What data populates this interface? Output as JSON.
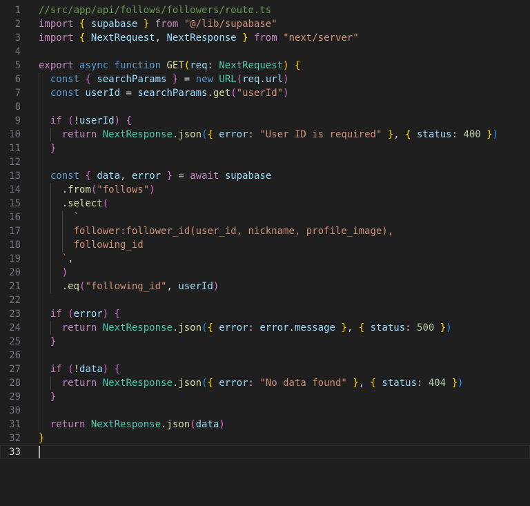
{
  "editor": {
    "file_comment": "//src/app/api/follows/followers/route.ts",
    "lines": [
      {
        "n": "1",
        "indent": 0,
        "tokens": [
          [
            "com",
            "//src/app/api/follows/followers/route.ts"
          ]
        ]
      },
      {
        "n": "2",
        "indent": 0,
        "tokens": [
          [
            "kw",
            "import"
          ],
          [
            "pl",
            " "
          ],
          [
            "b1",
            "{"
          ],
          [
            "pl",
            " "
          ],
          [
            "var",
            "supabase"
          ],
          [
            "pl",
            " "
          ],
          [
            "b1",
            "}"
          ],
          [
            "pl",
            " "
          ],
          [
            "kw",
            "from"
          ],
          [
            "pl",
            " "
          ],
          [
            "str",
            "\"@/lib/supabase\""
          ]
        ]
      },
      {
        "n": "3",
        "indent": 0,
        "tokens": [
          [
            "kw",
            "import"
          ],
          [
            "pl",
            " "
          ],
          [
            "b1",
            "{"
          ],
          [
            "pl",
            " "
          ],
          [
            "var",
            "NextRequest"
          ],
          [
            "pl",
            ", "
          ],
          [
            "var",
            "NextResponse"
          ],
          [
            "pl",
            " "
          ],
          [
            "b1",
            "}"
          ],
          [
            "pl",
            " "
          ],
          [
            "kw",
            "from"
          ],
          [
            "pl",
            " "
          ],
          [
            "str",
            "\"next/server\""
          ]
        ]
      },
      {
        "n": "4",
        "indent": 0,
        "tokens": []
      },
      {
        "n": "5",
        "indent": 0,
        "tokens": [
          [
            "kw",
            "export"
          ],
          [
            "pl",
            " "
          ],
          [
            "dec",
            "async"
          ],
          [
            "pl",
            " "
          ],
          [
            "dec",
            "function"
          ],
          [
            "pl",
            " "
          ],
          [
            "fn",
            "GET"
          ],
          [
            "b1",
            "("
          ],
          [
            "var",
            "req"
          ],
          [
            "pl",
            ": "
          ],
          [
            "type",
            "NextRequest"
          ],
          [
            "b1",
            ")"
          ],
          [
            "pl",
            " "
          ],
          [
            "b1",
            "{"
          ]
        ]
      },
      {
        "n": "6",
        "indent": 1,
        "tokens": [
          [
            "dec",
            "const"
          ],
          [
            "pl",
            " "
          ],
          [
            "b2",
            "{"
          ],
          [
            "pl",
            " "
          ],
          [
            "var",
            "searchParams"
          ],
          [
            "pl",
            " "
          ],
          [
            "b2",
            "}"
          ],
          [
            "pl",
            " = "
          ],
          [
            "dec",
            "new"
          ],
          [
            "pl",
            " "
          ],
          [
            "type",
            "URL"
          ],
          [
            "b2",
            "("
          ],
          [
            "var",
            "req"
          ],
          [
            "pl",
            "."
          ],
          [
            "var",
            "url"
          ],
          [
            "b2",
            ")"
          ]
        ]
      },
      {
        "n": "7",
        "indent": 1,
        "tokens": [
          [
            "dec",
            "const"
          ],
          [
            "pl",
            " "
          ],
          [
            "var",
            "userId"
          ],
          [
            "pl",
            " = "
          ],
          [
            "var",
            "searchParams"
          ],
          [
            "pl",
            "."
          ],
          [
            "fn",
            "get"
          ],
          [
            "b2",
            "("
          ],
          [
            "str",
            "\"userId\""
          ],
          [
            "b2",
            ")"
          ]
        ]
      },
      {
        "n": "8",
        "indent": 1,
        "tokens": []
      },
      {
        "n": "9",
        "indent": 1,
        "tokens": [
          [
            "kw",
            "if"
          ],
          [
            "pl",
            " "
          ],
          [
            "b2",
            "("
          ],
          [
            "pl",
            "!"
          ],
          [
            "var",
            "userId"
          ],
          [
            "b2",
            ")"
          ],
          [
            "pl",
            " "
          ],
          [
            "b2",
            "{"
          ]
        ]
      },
      {
        "n": "10",
        "indent": 2,
        "tokens": [
          [
            "kw",
            "return"
          ],
          [
            "pl",
            " "
          ],
          [
            "type",
            "NextResponse"
          ],
          [
            "pl",
            "."
          ],
          [
            "fn",
            "json"
          ],
          [
            "b3",
            "("
          ],
          [
            "b1",
            "{"
          ],
          [
            "pl",
            " "
          ],
          [
            "var",
            "error"
          ],
          [
            "pl",
            ": "
          ],
          [
            "str",
            "\"User ID is required\""
          ],
          [
            "pl",
            " "
          ],
          [
            "b1",
            "}"
          ],
          [
            "pl",
            ", "
          ],
          [
            "b1",
            "{"
          ],
          [
            "pl",
            " "
          ],
          [
            "var",
            "status"
          ],
          [
            "pl",
            ": "
          ],
          [
            "num",
            "400"
          ],
          [
            "pl",
            " "
          ],
          [
            "b1",
            "}"
          ],
          [
            "b3",
            ")"
          ]
        ]
      },
      {
        "n": "11",
        "indent": 1,
        "tokens": [
          [
            "b2",
            "}"
          ]
        ]
      },
      {
        "n": "12",
        "indent": 1,
        "tokens": []
      },
      {
        "n": "13",
        "indent": 1,
        "tokens": [
          [
            "dec",
            "const"
          ],
          [
            "pl",
            " "
          ],
          [
            "b2",
            "{"
          ],
          [
            "pl",
            " "
          ],
          [
            "var",
            "data"
          ],
          [
            "pl",
            ", "
          ],
          [
            "var",
            "error"
          ],
          [
            "pl",
            " "
          ],
          [
            "b2",
            "}"
          ],
          [
            "pl",
            " = "
          ],
          [
            "kw",
            "await"
          ],
          [
            "pl",
            " "
          ],
          [
            "var",
            "supabase"
          ]
        ]
      },
      {
        "n": "14",
        "indent": 2,
        "tokens": [
          [
            "pl",
            "."
          ],
          [
            "fn",
            "from"
          ],
          [
            "b2",
            "("
          ],
          [
            "str",
            "\"follows\""
          ],
          [
            "b2",
            ")"
          ]
        ]
      },
      {
        "n": "15",
        "indent": 2,
        "tokens": [
          [
            "pl",
            "."
          ],
          [
            "fn",
            "select"
          ],
          [
            "b2",
            "("
          ]
        ]
      },
      {
        "n": "16",
        "indent": 3,
        "tokens": [
          [
            "str",
            "`"
          ]
        ]
      },
      {
        "n": "17",
        "indent": 3,
        "tokens": [
          [
            "str",
            "follower:follower_id(user_id, nickname, profile_image),"
          ]
        ]
      },
      {
        "n": "18",
        "indent": 3,
        "tokens": [
          [
            "str",
            "following_id"
          ]
        ]
      },
      {
        "n": "19",
        "indent": 2,
        "tokens": [
          [
            "str",
            "`"
          ],
          [
            "pl",
            ","
          ]
        ]
      },
      {
        "n": "20",
        "indent": 2,
        "tokens": [
          [
            "b2",
            ")"
          ]
        ]
      },
      {
        "n": "21",
        "indent": 2,
        "tokens": [
          [
            "pl",
            "."
          ],
          [
            "fn",
            "eq"
          ],
          [
            "b2",
            "("
          ],
          [
            "str",
            "\"following_id\""
          ],
          [
            "pl",
            ", "
          ],
          [
            "var",
            "userId"
          ],
          [
            "b2",
            ")"
          ]
        ]
      },
      {
        "n": "22",
        "indent": 1,
        "tokens": []
      },
      {
        "n": "23",
        "indent": 1,
        "tokens": [
          [
            "kw",
            "if"
          ],
          [
            "pl",
            " "
          ],
          [
            "b2",
            "("
          ],
          [
            "var",
            "error"
          ],
          [
            "b2",
            ")"
          ],
          [
            "pl",
            " "
          ],
          [
            "b2",
            "{"
          ]
        ]
      },
      {
        "n": "24",
        "indent": 2,
        "tokens": [
          [
            "kw",
            "return"
          ],
          [
            "pl",
            " "
          ],
          [
            "type",
            "NextResponse"
          ],
          [
            "pl",
            "."
          ],
          [
            "fn",
            "json"
          ],
          [
            "b3",
            "("
          ],
          [
            "b1",
            "{"
          ],
          [
            "pl",
            " "
          ],
          [
            "var",
            "error"
          ],
          [
            "pl",
            ": "
          ],
          [
            "var",
            "error"
          ],
          [
            "pl",
            "."
          ],
          [
            "var",
            "message"
          ],
          [
            "pl",
            " "
          ],
          [
            "b1",
            "}"
          ],
          [
            "pl",
            ", "
          ],
          [
            "b1",
            "{"
          ],
          [
            "pl",
            " "
          ],
          [
            "var",
            "status"
          ],
          [
            "pl",
            ": "
          ],
          [
            "num",
            "500"
          ],
          [
            "pl",
            " "
          ],
          [
            "b1",
            "}"
          ],
          [
            "b3",
            ")"
          ]
        ]
      },
      {
        "n": "25",
        "indent": 1,
        "tokens": [
          [
            "b2",
            "}"
          ]
        ]
      },
      {
        "n": "26",
        "indent": 1,
        "tokens": []
      },
      {
        "n": "27",
        "indent": 1,
        "tokens": [
          [
            "kw",
            "if"
          ],
          [
            "pl",
            " "
          ],
          [
            "b2",
            "("
          ],
          [
            "pl",
            "!"
          ],
          [
            "var",
            "data"
          ],
          [
            "b2",
            ")"
          ],
          [
            "pl",
            " "
          ],
          [
            "b2",
            "{"
          ]
        ]
      },
      {
        "n": "28",
        "indent": 2,
        "tokens": [
          [
            "kw",
            "return"
          ],
          [
            "pl",
            " "
          ],
          [
            "type",
            "NextResponse"
          ],
          [
            "pl",
            "."
          ],
          [
            "fn",
            "json"
          ],
          [
            "b3",
            "("
          ],
          [
            "b1",
            "{"
          ],
          [
            "pl",
            " "
          ],
          [
            "var",
            "error"
          ],
          [
            "pl",
            ": "
          ],
          [
            "str",
            "\"No data found\""
          ],
          [
            "pl",
            " "
          ],
          [
            "b1",
            "}"
          ],
          [
            "pl",
            ", "
          ],
          [
            "b1",
            "{"
          ],
          [
            "pl",
            " "
          ],
          [
            "var",
            "status"
          ],
          [
            "pl",
            ": "
          ],
          [
            "num",
            "404"
          ],
          [
            "pl",
            " "
          ],
          [
            "b1",
            "}"
          ],
          [
            "b3",
            ")"
          ]
        ]
      },
      {
        "n": "29",
        "indent": 1,
        "tokens": [
          [
            "b2",
            "}"
          ]
        ]
      },
      {
        "n": "30",
        "indent": 1,
        "tokens": []
      },
      {
        "n": "31",
        "indent": 1,
        "tokens": [
          [
            "kw",
            "return"
          ],
          [
            "pl",
            " "
          ],
          [
            "type",
            "NextResponse"
          ],
          [
            "pl",
            "."
          ],
          [
            "fn",
            "json"
          ],
          [
            "b2",
            "("
          ],
          [
            "var",
            "data"
          ],
          [
            "b2",
            ")"
          ]
        ]
      },
      {
        "n": "32",
        "indent": 0,
        "tokens": [
          [
            "b1",
            "}"
          ]
        ]
      },
      {
        "n": "33",
        "indent": 0,
        "tokens": [],
        "current": true
      }
    ]
  },
  "colors": {
    "background": "#1f1f1f",
    "comment": "#6a9955",
    "keyword": "#c586c0",
    "declaration": "#569cd6",
    "function": "#dcdcaa",
    "variable": "#9cdcfe",
    "type": "#4ec9b0",
    "string": "#ce9178",
    "number": "#b5cea8"
  }
}
